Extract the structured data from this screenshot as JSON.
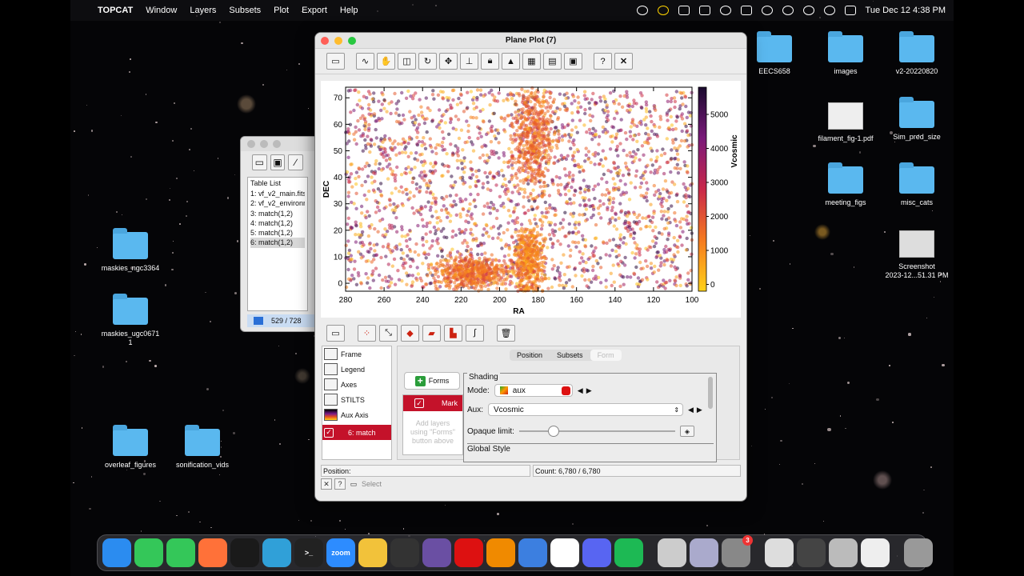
{
  "menubar": {
    "app_name": "TOPCAT",
    "items": [
      "Window",
      "Layers",
      "Subsets",
      "Plot",
      "Export",
      "Help"
    ],
    "clock": "Tue Dec 12  4:38 PM",
    "status_icons": [
      "record-icon",
      "yellow-circle-icon",
      "cloud-icon",
      "hd-icon",
      "play-icon",
      "battery-icon",
      "time-machine-icon",
      "wifi-icon",
      "user-icon",
      "search-icon",
      "control-center-icon"
    ]
  },
  "desktop_icons": [
    {
      "label": "EECS658",
      "type": "folder"
    },
    {
      "label": "images",
      "type": "folder"
    },
    {
      "label": "v2-20220820",
      "type": "folder"
    },
    {
      "label": "filament_fig-1.pdf",
      "type": "file"
    },
    {
      "label": "Sim_pred_size",
      "type": "folder"
    },
    {
      "label": "meeting_figs",
      "type": "folder"
    },
    {
      "label": "misc_cats",
      "type": "folder"
    },
    {
      "label": "Screenshot\n2023-12...51.31 PM",
      "type": "file"
    },
    {
      "label": "maskies_ngc3364",
      "type": "folder"
    },
    {
      "label": "maskies_ugc0671\n1",
      "type": "folder"
    },
    {
      "label": "overleaf_figures",
      "type": "folder"
    },
    {
      "label": "sonification_vids",
      "type": "folder"
    }
  ],
  "topcat_window": {
    "table_list_title": "Table List",
    "tables": [
      "1: vf_v2_main.fits",
      "2: vf_v2_environme",
      "3: match(1,2)",
      "4: match(1,2)",
      "5: match(1,2)",
      "6: match(1,2)"
    ],
    "selected_index": 5,
    "status": "529 / 728"
  },
  "plot_window": {
    "title": "Plane Plot (7)",
    "toolbar_icons": [
      "new-window-icon",
      "axis-lock-icon",
      "zoom-icon",
      "subset-icon",
      "replot-icon",
      "navigate-icon",
      "resize-icon",
      "lock-icon",
      "lock-color-icon",
      "colormap-icon",
      "table-icon",
      "image-export-icon",
      "help-icon",
      "close-icon"
    ],
    "layer_toolbar_icons": [
      "layer-window-icon",
      "scatter-layer-icon",
      "pairs-layer-icon",
      "shapes-layer-icon",
      "density-layer-icon",
      "histogram-layer-icon",
      "function-layer-icon",
      "delete-layer-icon"
    ],
    "control_items": [
      {
        "label": "Frame",
        "icon": "frame-icon"
      },
      {
        "label": "Legend",
        "icon": "legend-icon"
      },
      {
        "label": "Axes",
        "icon": "axes-icon"
      },
      {
        "label": "STILTS",
        "icon": "stilts-icon"
      },
      {
        "label": "Aux Axis",
        "icon": "aux-axis-icon"
      }
    ],
    "layer_item": {
      "label": "6: match",
      "checked": true
    },
    "config_tabs": [
      "Position",
      "Subsets",
      "Form"
    ],
    "forms_button": "Forms",
    "form_list_item": "Mark",
    "form_hint": "Add layers\nusing \"Forms\"\nbutton above",
    "shading": {
      "title": "Shading",
      "mode_label": "Mode:",
      "mode_value": "aux",
      "aux_label": "Aux:",
      "aux_value": "Vcosmic",
      "opaque_label": "Opaque limit:",
      "opaque_fraction": 0.22,
      "global_style": "Global Style"
    },
    "position_label": "Position:",
    "count_label": "Count: 6,780 / 6,780",
    "select_label": "Select"
  },
  "chart_data": {
    "type": "scatter",
    "xlabel": "RA",
    "ylabel": "DEC",
    "xlim": [
      280,
      100
    ],
    "ylim": [
      -3,
      74
    ],
    "xticks": [
      280,
      260,
      240,
      220,
      200,
      180,
      160,
      140,
      120,
      100
    ],
    "yticks": [
      0,
      10,
      20,
      30,
      40,
      50,
      60,
      70
    ],
    "colorbar": {
      "label": "Vcosmic",
      "ticks": [
        0,
        1000,
        2000,
        3000,
        4000,
        5000
      ],
      "range": [
        -200,
        5800
      ]
    },
    "colors": {
      "low": "#ffd21a",
      "mid_low": "#f57a1f",
      "mid": "#c9284a",
      "mid_high": "#7a1a7a",
      "high": "#1a0a2e"
    },
    "n_points": 6780,
    "structures": [
      {
        "name": "",
        "ra": 185,
        "dec": 8,
        "ra_sd": 4,
        "dec_sd": 7,
        "v": 1200
      },
      {
        "name": "",
        "ra": 183,
        "dec": 55,
        "ra_sd": 6,
        "dec_sd": 10,
        "v": 1600
      },
      {
        "name": "",
        "ra": 215,
        "dec": 4,
        "ra_sd": 9,
        "dec_sd": 3,
        "v": 1500
      }
    ]
  },
  "dock": [
    {
      "name": "finder-icon",
      "label": "",
      "color": "#2b8cf0"
    },
    {
      "name": "facetime-icon",
      "label": "",
      "color": "#34c759"
    },
    {
      "name": "messages-icon",
      "label": "",
      "color": "#34c759"
    },
    {
      "name": "firefox-icon",
      "label": "",
      "color": "#ff7139"
    },
    {
      "name": "ds9-icon",
      "label": "",
      "color": "#1a1a1a"
    },
    {
      "name": "sun-app-icon",
      "label": "",
      "color": "#30a0d8"
    },
    {
      "name": "terminal-icon",
      "label": ">_",
      "color": "#222"
    },
    {
      "name": "zoom-icon",
      "label": "zoom",
      "color": "#2d8cff"
    },
    {
      "name": "topcat-icon",
      "label": "",
      "color": "#f2c23a"
    },
    {
      "name": "xquartz-icon",
      "label": "",
      "color": "#333"
    },
    {
      "name": "emacs-icon",
      "label": "",
      "color": "#6a4fa3"
    },
    {
      "name": "acrobat-icon",
      "label": "",
      "color": "#d11"
    },
    {
      "name": "vlc-icon",
      "label": "",
      "color": "#f08a00"
    },
    {
      "name": "xcode-icon",
      "label": "",
      "color": "#3c7fe0"
    },
    {
      "name": "slack-icon",
      "label": "",
      "color": "#fff"
    },
    {
      "name": "discord-icon",
      "label": "",
      "color": "#5865f2"
    },
    {
      "name": "spotify-icon",
      "label": "",
      "color": "#1db954"
    },
    {
      "name": "quicktime-icon",
      "label": "",
      "color": "#ccc"
    },
    {
      "name": "preview-icon",
      "label": "",
      "color": "#aac"
    },
    {
      "name": "settings-icon",
      "label": "3",
      "color": "#888"
    },
    {
      "name": "recent-window-1-icon",
      "label": "",
      "color": "#ddd"
    },
    {
      "name": "recent-window-2-icon",
      "label": "",
      "color": "#444"
    },
    {
      "name": "recent-window-3-icon",
      "label": "",
      "color": "#bbb"
    },
    {
      "name": "recent-window-4-icon",
      "label": "",
      "color": "#eee"
    },
    {
      "name": "trash-icon",
      "label": "",
      "color": "#999"
    }
  ]
}
